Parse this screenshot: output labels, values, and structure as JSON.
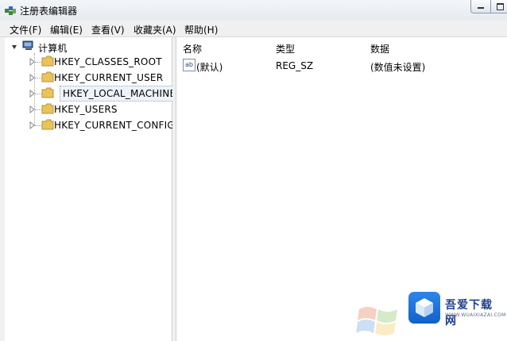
{
  "window": {
    "title": "注册表编辑器"
  },
  "menu": [
    "文件(F)",
    "编辑(E)",
    "查看(V)",
    "收藏夹(A)",
    "帮助(H)"
  ],
  "tree": {
    "root": "计算机",
    "items": [
      {
        "label": "HKEY_CLASSES_ROOT"
      },
      {
        "label": "HKEY_CURRENT_USER"
      },
      {
        "label": "HKEY_LOCAL_MACHINE",
        "selected": true
      },
      {
        "label": "HKEY_USERS"
      },
      {
        "label": "HKEY_CURRENT_CONFIG"
      }
    ]
  },
  "list": {
    "columns": [
      "名称",
      "类型",
      "数据"
    ],
    "rows": [
      {
        "name": "(默认)",
        "type": "REG_SZ",
        "data": "(数值未设置)"
      }
    ]
  },
  "watermark": {
    "brand": "吾爱下载网",
    "site": "WWW.WUAIXIAZAI.COM"
  },
  "colors": {
    "folder": "#e8c45a",
    "selection_border": "#9aa9bd",
    "watermark_blue": "#1161c9"
  }
}
